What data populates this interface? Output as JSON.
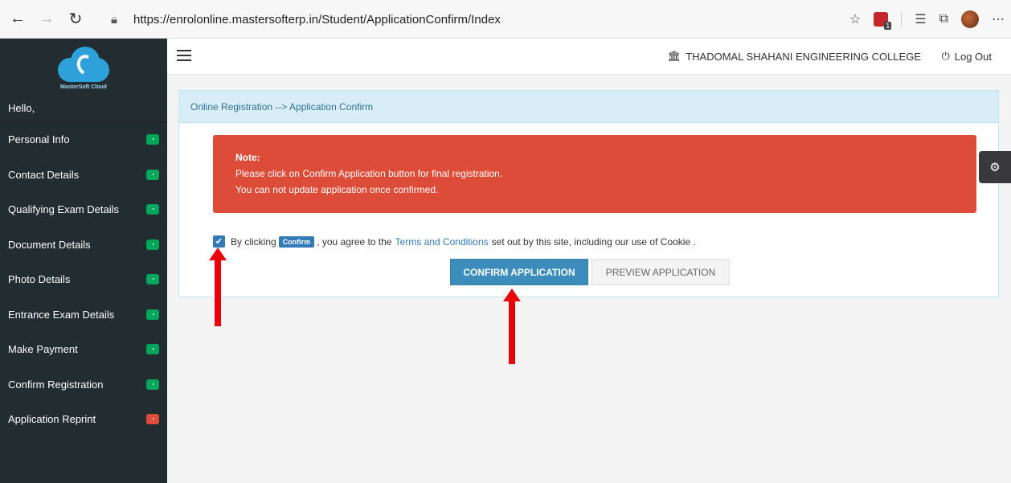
{
  "browser": {
    "url": "https://enrolonline.mastersofterp.in/Student/ApplicationConfirm/Index",
    "ext_badge": "1"
  },
  "sidebar": {
    "logo_text": "MasterSoft Cloud",
    "greeting": "Hello,",
    "items": [
      {
        "label": "Personal Info",
        "status": "complete",
        "color": "#00a65a"
      },
      {
        "label": "Contact Details",
        "status": "complete",
        "color": "#00a65a"
      },
      {
        "label": "Qualifying Exam Details",
        "status": "complete",
        "color": "#00a65a"
      },
      {
        "label": "Document Details",
        "status": "complete",
        "color": "#00a65a"
      },
      {
        "label": "Photo Details",
        "status": "complete",
        "color": "#00a65a"
      },
      {
        "label": "Entrance Exam Details",
        "status": "complete",
        "color": "#00a65a"
      },
      {
        "label": "Make Payment",
        "status": "complete",
        "color": "#00a65a"
      },
      {
        "label": "Confirm Registration",
        "status": "complete",
        "color": "#00a65a"
      },
      {
        "label": "Application Reprint",
        "status": "pending",
        "color": "#dd4b39"
      }
    ]
  },
  "header": {
    "college": "THADOMAL SHAHANI ENGINEERING COLLEGE",
    "logout": "Log Out"
  },
  "panel": {
    "title": "Online Registration --> Application Confirm",
    "note_title": "Note:",
    "note_line1": "Please click on Confirm Application button for final registration.",
    "note_line2": "You can not update application once confirmed.",
    "agree_prefix": "By clicking",
    "agree_badge": "Confirm",
    "agree_mid": ", you agree to the",
    "agree_link": "Terms and Conditions",
    "agree_suffix": "set out by this site, including our use of Cookie .",
    "confirm_button": "CONFIRM APPLICATION",
    "preview_button": "PREVIEW APPLICATION"
  },
  "colors": {
    "sidebar_bg": "#222d32",
    "alert_bg": "#dd4b39",
    "primary": "#3c8dbc",
    "annotation_arrow": "#e8000b"
  }
}
